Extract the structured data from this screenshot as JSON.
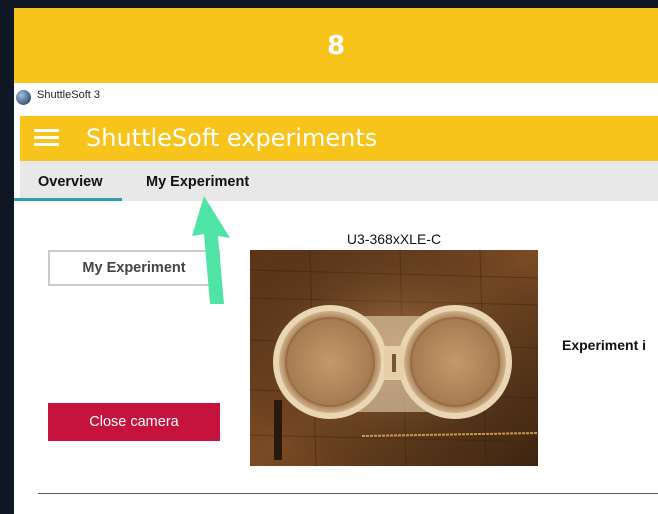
{
  "step": {
    "number": "8"
  },
  "window": {
    "title": "ShuttleSoft 3",
    "icon": "app-globe-icon"
  },
  "appbar": {
    "menu_icon": "hamburger-menu-icon",
    "title": "ShuttleSoft experiments"
  },
  "tabs": [
    {
      "label": "Overview",
      "active": true
    },
    {
      "label": "My Experiment",
      "active": false
    }
  ],
  "main": {
    "my_experiment_button": "My Experiment",
    "close_camera_button": "Close camera",
    "camera_label": "U3-368xXLE-C",
    "experiment_label": "Experiment i"
  },
  "colors": {
    "accent_yellow": "#f7c41c",
    "close_button": "#c5133e",
    "tab_underline": "#2e9db3",
    "arrow": "#4fe3a5",
    "background": "#0f1725"
  },
  "annotation": {
    "arrow_icon": "pointer-arrow-icon"
  }
}
